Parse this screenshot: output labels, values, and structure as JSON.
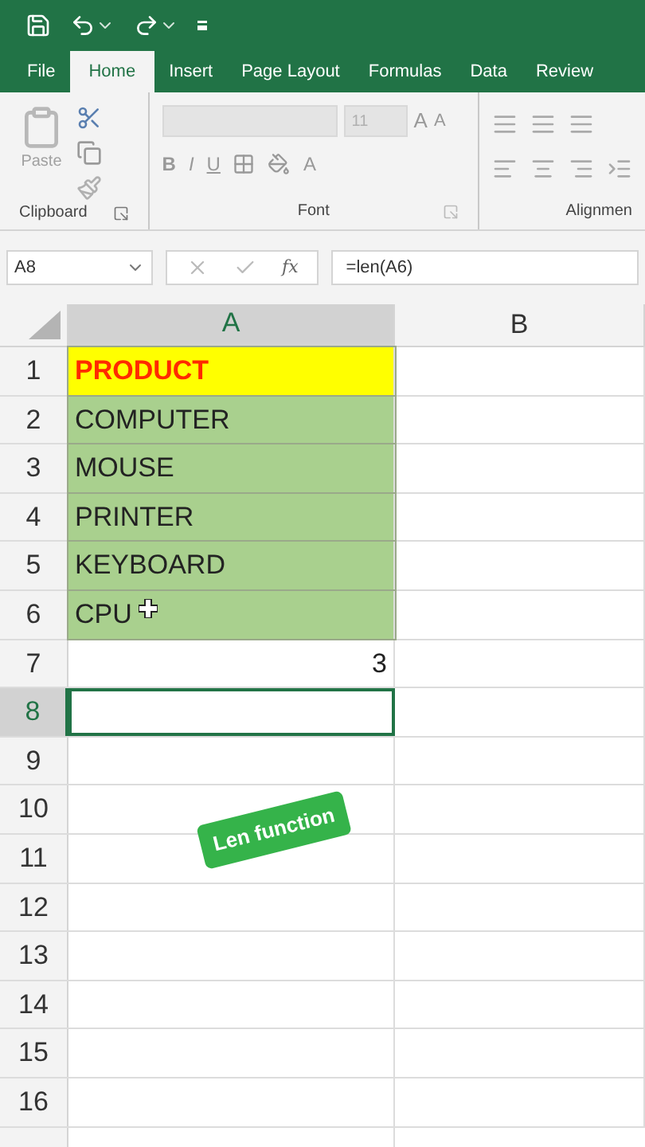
{
  "quick_access": {
    "undo_dropdown": true,
    "redo_dropdown": true
  },
  "tabs": [
    {
      "label": "File",
      "selected": false
    },
    {
      "label": "Home",
      "selected": true
    },
    {
      "label": "Insert",
      "selected": false
    },
    {
      "label": "Page Layout",
      "selected": false
    },
    {
      "label": "Formulas",
      "selected": false
    },
    {
      "label": "Data",
      "selected": false
    },
    {
      "label": "Review",
      "selected": false
    }
  ],
  "ribbon": {
    "paste_label": "Paste",
    "font_size": "11",
    "bold": "B",
    "italic": "I",
    "underline": "U",
    "font_color": "A",
    "grow_font": "A",
    "shrink_font": "A",
    "function_label": "fx",
    "groups": [
      "Clipboard",
      "Font",
      "Alignmen"
    ]
  },
  "formula_bar": {
    "name_box": "A8",
    "formula": "=len(A6)"
  },
  "columns": [
    {
      "label": "A",
      "selected": true
    },
    {
      "label": "B",
      "selected": false
    }
  ],
  "rows": [
    {
      "number": "1",
      "selected": false,
      "cell": {
        "kind": "header",
        "value": "PRODUCT",
        "color": "#ffff00"
      }
    },
    {
      "number": "2",
      "selected": false,
      "cell": {
        "kind": "text",
        "value": "COMPUTER",
        "color": "#a9d08e"
      }
    },
    {
      "number": "3",
      "selected": false,
      "cell": {
        "kind": "text",
        "value": "MOUSE",
        "color": "#a9d08e"
      }
    },
    {
      "number": "4",
      "selected": false,
      "cell": {
        "kind": "text",
        "value": "PRINTER",
        "color": "#a9d08e"
      }
    },
    {
      "number": "5",
      "selected": false,
      "cell": {
        "kind": "text",
        "value": "KEYBOARD",
        "color": "#a9d08e"
      }
    },
    {
      "number": "6",
      "selected": false,
      "cell": {
        "kind": "text",
        "value": "CPU",
        "color": "#a9d08e"
      },
      "cursor": true
    },
    {
      "number": "7",
      "selected": false,
      "cell": {
        "kind": "number",
        "value": "3"
      }
    },
    {
      "number": "8",
      "selected": true,
      "cell": {
        "kind": "empty"
      }
    },
    {
      "number": "9",
      "selected": false,
      "cell": {
        "kind": "empty"
      }
    },
    {
      "number": "10",
      "selected": false,
      "cell": {
        "kind": "empty"
      }
    },
    {
      "number": "11",
      "selected": false,
      "cell": {
        "kind": "empty"
      }
    },
    {
      "number": "12",
      "selected": false,
      "cell": {
        "kind": "empty"
      }
    },
    {
      "number": "13",
      "selected": false,
      "cell": {
        "kind": "empty"
      }
    },
    {
      "number": "14",
      "selected": false,
      "cell": {
        "kind": "empty"
      }
    },
    {
      "number": "15",
      "selected": false,
      "cell": {
        "kind": "empty"
      }
    },
    {
      "number": "16",
      "selected": false,
      "cell": {
        "kind": "empty"
      }
    }
  ],
  "overlay_label": "Len function"
}
